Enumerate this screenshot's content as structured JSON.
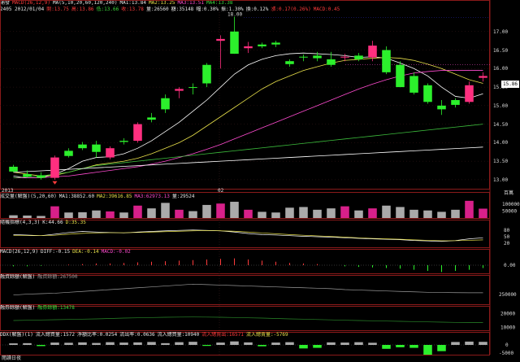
{
  "header": {
    "row1": [
      {
        "t": "浦發",
        "c": "wt"
      },
      {
        "t": "MACD(26,12,9)",
        "c": "rd"
      },
      {
        "t": "MA(5,10,20,60,120,240)",
        "c": "wt"
      },
      {
        "t": "MA1:13.84",
        "c": "wt"
      },
      {
        "t": "MA2:13.25",
        "c": "yl"
      },
      {
        "t": "MA3:13.51",
        "c": "mg"
      },
      {
        "t": "MA4:13.38",
        "c": "gr"
      }
    ],
    "row2": [
      {
        "t": "2405 2012/01/04",
        "c": "wt"
      },
      {
        "t": "開:13.75",
        "c": "rd"
      },
      {
        "t": "高:13.86",
        "c": "rd"
      },
      {
        "t": "低:13.66",
        "c": "gr"
      },
      {
        "t": "收:13.78",
        "c": "rd"
      },
      {
        "t": "量:26560",
        "c": "wt"
      },
      {
        "t": "額:35148",
        "c": "wt"
      },
      {
        "t": "幅:0.30%",
        "c": "wt"
      },
      {
        "t": "振:1.30%",
        "c": "wt"
      },
      {
        "t": "換:0.12%",
        "c": "wt"
      },
      {
        "t": "漲:0.17(0.26%)",
        "c": "rd"
      },
      {
        "t": "MACD:0.45",
        "c": "rd"
      }
    ]
  },
  "price_axis": [
    "17.00",
    "16.50",
    "16.00",
    "15.50",
    "15.00",
    "14.50",
    "14.00",
    "13.50",
    "13.00"
  ],
  "current_price": "15.86",
  "high_marker": "18.00",
  "date_labels": [
    "2013",
    "02"
  ],
  "vol_header": [
    {
      "t": "成交量(解盤)(5,20,60)",
      "c": "wt"
    },
    {
      "t": "MA1:38852.60",
      "c": "wt"
    },
    {
      "t": "MA2:39616.85",
      "c": "yl"
    },
    {
      "t": "MA3:62973.13",
      "c": "mg"
    },
    {
      "t": "量:29524",
      "c": "wt"
    }
  ],
  "vol_axis": [
    "100000",
    "50000"
  ],
  "kdj_header": [
    {
      "t": "隨機指標(4,3,3)",
      "c": "wt"
    },
    {
      "t": "K:44.66",
      "c": "wt"
    },
    {
      "t": "D:35.35",
      "c": "yl"
    }
  ],
  "kdj_axis": [
    "80",
    "50",
    "20"
  ],
  "macd_header": [
    {
      "t": "MACD(26,12,9)",
      "c": "wt"
    },
    {
      "t": "DIFF:-0.15",
      "c": "wt"
    },
    {
      "t": "DEA:-0.14",
      "c": "yl"
    },
    {
      "t": "MACD:-0.02",
      "c": "mg"
    }
  ],
  "macd_axis": [
    "0.00"
  ],
  "margin1_header": [
    {
      "t": "融資餘額(解盤)",
      "c": "wt"
    },
    {
      "t": "融資餘額:267500",
      "c": "gy"
    }
  ],
  "margin1_axis": [
    "250000"
  ],
  "margin2_header": [
    {
      "t": "融券餘額(解盤)",
      "c": "wt"
    },
    {
      "t": "融券餘額:13478",
      "c": "gr"
    }
  ],
  "margin2_axis": [
    "20000",
    "10000"
  ],
  "flow_header": [
    {
      "t": "DDX(解盤)(1)",
      "c": "wt"
    },
    {
      "t": "流入總買量:1572",
      "c": "wt"
    },
    {
      "t": "淨額比率:0.0254",
      "c": "wt"
    },
    {
      "t": "流出率:0.0636",
      "c": "wt"
    },
    {
      "t": "流入總買量:10940",
      "c": "wt"
    },
    {
      "t": "流入總賣出:16571",
      "c": "rd"
    },
    {
      "t": "流入總賣量:-5769",
      "c": "yl"
    }
  ],
  "flow_axis": [
    "0",
    "-5000"
  ],
  "axis_unit": "百萬",
  "bottom_label": "閱讀日夜",
  "colors": {
    "up": "#ff2f7f",
    "down": "#2cf02c",
    "ma5": "#ffffff",
    "ma10": "#e8e04a",
    "ma20": "#ff4bd0",
    "ma60": "#3cbc3c",
    "ma120": "#ffffff"
  },
  "chart_data": {
    "type": "candlestick",
    "candles": [
      {
        "o": 13.35,
        "h": 13.4,
        "l": 13.2,
        "c": 13.22
      },
      {
        "o": 13.15,
        "h": 13.25,
        "l": 13.05,
        "c": 13.08
      },
      {
        "o": 13.12,
        "h": 13.2,
        "l": 13.0,
        "c": 13.05
      },
      {
        "o": 13.05,
        "h": 13.65,
        "l": 13.0,
        "c": 13.6
      },
      {
        "o": 13.78,
        "h": 13.85,
        "l": 13.6,
        "c": 13.64
      },
      {
        "o": 13.95,
        "h": 14.02,
        "l": 13.8,
        "c": 13.85
      },
      {
        "o": 13.95,
        "h": 14.05,
        "l": 13.6,
        "c": 13.75
      },
      {
        "o": 13.6,
        "h": 13.9,
        "l": 13.55,
        "c": 13.85
      },
      {
        "o": 14.05,
        "h": 14.12,
        "l": 13.95,
        "c": 14.02
      },
      {
        "o": 14.05,
        "h": 14.55,
        "l": 14.0,
        "c": 14.5
      },
      {
        "o": 14.68,
        "h": 14.8,
        "l": 14.55,
        "c": 14.62
      },
      {
        "o": 15.2,
        "h": 15.3,
        "l": 14.8,
        "c": 14.9
      },
      {
        "o": 15.4,
        "h": 15.5,
        "l": 15.2,
        "c": 15.45
      },
      {
        "o": 15.5,
        "h": 15.6,
        "l": 15.3,
        "c": 15.48
      },
      {
        "o": 16.1,
        "h": 16.15,
        "l": 15.5,
        "c": 15.6
      },
      {
        "o": 16.75,
        "h": 16.9,
        "l": 16.0,
        "c": 16.8
      },
      {
        "o": 17.0,
        "h": 17.4,
        "l": 16.4,
        "c": 16.4
      },
      {
        "o": 16.55,
        "h": 16.72,
        "l": 16.42,
        "c": 16.6
      },
      {
        "o": 16.65,
        "h": 16.7,
        "l": 16.55,
        "c": 16.6
      },
      {
        "o": 16.7,
        "h": 16.75,
        "l": 16.58,
        "c": 16.65
      },
      {
        "o": 16.2,
        "h": 16.25,
        "l": 16.05,
        "c": 16.12
      },
      {
        "o": 16.32,
        "h": 16.38,
        "l": 16.2,
        "c": 16.3
      },
      {
        "o": 16.35,
        "h": 16.45,
        "l": 16.2,
        "c": 16.28
      },
      {
        "o": 16.25,
        "h": 16.45,
        "l": 16.05,
        "c": 16.1
      },
      {
        "o": 16.3,
        "h": 16.4,
        "l": 16.2,
        "c": 16.32
      },
      {
        "o": 16.35,
        "h": 16.42,
        "l": 16.2,
        "c": 16.25
      },
      {
        "o": 16.3,
        "h": 16.75,
        "l": 16.2,
        "c": 16.62
      },
      {
        "o": 16.5,
        "h": 16.6,
        "l": 15.85,
        "c": 15.9
      },
      {
        "o": 16.1,
        "h": 16.2,
        "l": 15.5,
        "c": 15.5
      },
      {
        "o": 15.8,
        "h": 15.9,
        "l": 15.3,
        "c": 15.35
      },
      {
        "o": 15.55,
        "h": 15.6,
        "l": 15.05,
        "c": 15.1
      },
      {
        "o": 15.0,
        "h": 15.15,
        "l": 14.75,
        "c": 14.9
      },
      {
        "o": 15.15,
        "h": 15.2,
        "l": 14.95,
        "c": 15.02
      },
      {
        "o": 15.1,
        "h": 15.65,
        "l": 15.05,
        "c": 15.55
      },
      {
        "o": 15.75,
        "h": 15.9,
        "l": 15.65,
        "c": 15.8
      }
    ],
    "ma_series": [
      {
        "values": [
          13.1,
          13.05,
          13.05,
          13.15,
          13.3,
          13.5,
          13.6,
          13.62,
          13.7,
          13.85,
          14.05,
          14.3,
          14.55,
          14.85,
          15.15,
          15.5,
          15.85,
          16.1,
          16.25,
          16.35,
          16.4,
          16.42,
          16.4,
          16.38,
          16.35,
          16.3,
          16.32,
          16.28,
          16.15,
          16.0,
          15.8,
          15.5,
          15.25,
          15.2,
          15.32
        ]
      },
      {
        "values": [
          13.2,
          13.15,
          13.1,
          13.12,
          13.2,
          13.3,
          13.4,
          13.45,
          13.5,
          13.58,
          13.7,
          13.85,
          14.0,
          14.2,
          14.45,
          14.7,
          14.95,
          15.2,
          15.45,
          15.65,
          15.8,
          15.95,
          16.05,
          16.15,
          16.22,
          16.25,
          16.28,
          16.3,
          16.28,
          16.22,
          16.12,
          16.0,
          15.85,
          15.7,
          15.6
        ]
      },
      {
        "values": [
          13.05,
          13.05,
          13.05,
          13.08,
          13.1,
          13.15,
          13.2,
          13.25,
          13.3,
          13.35,
          13.42,
          13.5,
          13.6,
          13.7,
          13.82,
          13.95,
          14.1,
          14.25,
          14.4,
          14.55,
          14.7,
          14.85,
          15.0,
          15.15,
          15.3,
          15.45,
          15.58,
          15.7,
          15.8,
          15.88,
          15.92,
          15.95,
          15.95,
          15.95,
          15.95
        ]
      },
      {
        "values": [
          13.05,
          13.08,
          13.1,
          13.15,
          13.2,
          13.3,
          13.38,
          13.42,
          13.46,
          13.5,
          13.54,
          13.58,
          13.62,
          13.66,
          13.7,
          13.74,
          13.78,
          13.82,
          13.86,
          13.9,
          13.94,
          13.98,
          14.02,
          14.06,
          14.1,
          14.14,
          14.18,
          14.22,
          14.26,
          14.3,
          14.34,
          14.38,
          14.42,
          14.46,
          14.5
        ]
      },
      {
        "values": [
          13.2,
          13.22,
          13.24,
          13.26,
          13.28,
          13.3,
          13.32,
          13.34,
          13.36,
          13.38,
          13.4,
          13.42,
          13.44,
          13.46,
          13.48,
          13.5,
          13.52,
          13.54,
          13.56,
          13.58,
          13.6,
          13.62,
          13.64,
          13.66,
          13.68,
          13.7,
          13.72,
          13.74,
          13.76,
          13.78,
          13.8,
          13.82,
          13.84,
          13.86,
          13.88
        ]
      }
    ],
    "volume": [
      20000,
      18000,
      15000,
      85000,
      40000,
      42000,
      55000,
      48000,
      40000,
      90000,
      70000,
      110000,
      60000,
      50000,
      95000,
      105000,
      118000,
      60000,
      45000,
      40000,
      75000,
      80000,
      60000,
      70000,
      85000,
      55000,
      70000,
      90000,
      80000,
      60000,
      55000,
      45000,
      60000,
      125000,
      68000
    ],
    "kdj_k": [
      60,
      58,
      55,
      62,
      70,
      75,
      72,
      70,
      68,
      72,
      75,
      78,
      80,
      82,
      80,
      78,
      72,
      65,
      60,
      58,
      55,
      52,
      50,
      48,
      45,
      42,
      40,
      38,
      36,
      32,
      30,
      28,
      32,
      40,
      45
    ],
    "kdj_d": [
      55,
      55,
      55,
      57,
      62,
      66,
      68,
      69,
      69,
      70,
      72,
      74,
      76,
      78,
      79,
      78,
      76,
      72,
      68,
      64,
      60,
      57,
      54,
      51,
      48,
      45,
      42,
      40,
      38,
      35,
      33,
      31,
      31,
      33,
      35
    ],
    "macd_bars": [
      -0.02,
      -0.02,
      -0.01,
      0.0,
      0.01,
      0.02,
      0.03,
      0.03,
      0.04,
      0.05,
      0.06,
      0.07,
      0.08,
      0.09,
      0.1,
      0.11,
      0.12,
      0.1,
      0.08,
      0.06,
      0.04,
      0.03,
      0.02,
      0.0,
      -0.02,
      -0.03,
      -0.04,
      -0.05,
      -0.06,
      -0.08,
      -0.1,
      -0.12,
      -0.1,
      -0.08,
      -0.05
    ],
    "margin1": [
      265000,
      266000,
      266500,
      267000,
      268000,
      269000,
      270000,
      271000,
      272000,
      273000,
      274000,
      275000,
      276000,
      277000,
      276500,
      276000,
      275500,
      275000,
      274500,
      274000,
      273500,
      273000,
      272500,
      272000,
      271000,
      270500,
      270000,
      269500,
      269000,
      268500,
      268000,
      267800,
      267600,
      267500,
      267500
    ],
    "margin2": [
      15000,
      15200,
      15400,
      15600,
      15800,
      16000,
      16200,
      16500,
      16800,
      17000,
      17200,
      17400,
      17500,
      17600,
      17500,
      17400,
      17200,
      17000,
      16800,
      16500,
      16200,
      16000,
      15700,
      15500,
      15200,
      15000,
      14800,
      14600,
      14400,
      14200,
      14000,
      13800,
      13600,
      13500,
      13478
    ],
    "flow": [
      800,
      900,
      -600,
      1200,
      1100,
      1300,
      1000,
      1400,
      1200,
      1300,
      1500,
      900,
      1400,
      1600,
      -500,
      1200,
      1800,
      1300,
      -700,
      1200,
      1400,
      -1800,
      -1500,
      1300,
      1200,
      1400,
      1100,
      -2000,
      -1200,
      -1500,
      -5000,
      -3200,
      1500,
      1700,
      1572
    ]
  }
}
